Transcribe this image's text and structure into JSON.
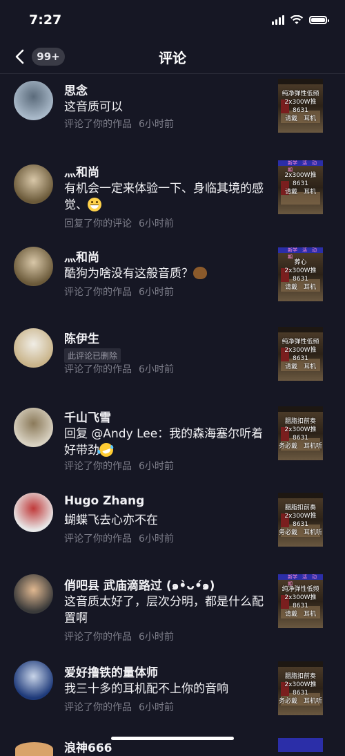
{
  "status_bar": {
    "time": "7:27"
  },
  "nav": {
    "back_badge": "99+",
    "title": "评论"
  },
  "items": [
    {
      "name": "思念",
      "comment": "这音质可以",
      "meta_action": "评论了你的作品",
      "meta_time": "6小时前",
      "thumb_text": "纯净弹性低频\n2x300W推8631\n请戴　耳机",
      "avatar_colors": [
        "#a9b9c9",
        "#5b6b7b"
      ]
    },
    {
      "name": "灬和尚",
      "comment": "有机会一定来体验一下、身临其境的感觉、",
      "emoji": "grin",
      "meta_action": "回复了你的评论",
      "meta_time": "6小时前",
      "thumb_text": "2x300W推8631\n请戴　耳机",
      "thumb_header": "新学　活　动　期",
      "avatar_colors": [
        "#6b5a3a",
        "#d8c7a8"
      ]
    },
    {
      "name": "灬和尚",
      "comment": "酷狗为啥没有这般音质？",
      "emoji": "poo",
      "meta_action": "评论了你的作品",
      "meta_time": "6小时前",
      "thumb_text": "葬心\n2x300W推8631\n请戴　耳机",
      "thumb_header": "新学　活　动　期",
      "avatar_colors": [
        "#6b5a3a",
        "#d8c7a8"
      ]
    },
    {
      "name": "陈伊生",
      "deleted": "此评论已删除",
      "meta_action": "评论了你的作品",
      "meta_time": "6小时前",
      "thumb_text": "纯净弹性低频\n2x300W推8631\n请戴　耳机",
      "avatar_colors": [
        "#c9b48a",
        "#f0ede6"
      ]
    },
    {
      "name": "千山飞雪",
      "comment": "回复 @Andy Lee：我的森海塞尔听着好带劲",
      "emoji": "laugh",
      "meta_action": "评论了你的作品",
      "meta_time": "6小时前",
      "thumb_text": "胭脂扣前奏\n2x300W推8631\n务必戴　耳机听",
      "avatar_colors": [
        "#d9d2c2",
        "#8b7a5a"
      ]
    },
    {
      "name": "Hugo Zhang",
      "comment": "蝴蝶飞去心亦不在",
      "meta_action": "评论了你的作品",
      "meta_time": "6小时前",
      "thumb_text": "胭脂扣前奏\n2x300W推8631\n务必戴　耳机听",
      "avatar_colors": [
        "#e8e8e8",
        "#c03a3a"
      ]
    },
    {
      "name": "俏吧县  武庙滴路过 (๑•̀ᴗ•́๑)",
      "comment": "这音质太好了，层次分明，都是什么配置啊",
      "meta_action": "评论了你的作品",
      "meta_time": "6小时前",
      "thumb_text": "纯净弹性低频\n2x300W推8631\n请戴　耳机",
      "thumb_header": "新学　活　动　期",
      "avatar_colors": [
        "#3a3a3a",
        "#e0b890"
      ]
    },
    {
      "name": "爱好撸铁的量体师",
      "comment": "我三十多的耳机配不上你的音响",
      "meta_action": "评论了你的作品",
      "meta_time": "6小时前",
      "thumb_text": "胭脂扣前奏\n2x300W推8631\n务必戴　耳机听",
      "avatar_colors": [
        "#1e3a7a",
        "#c8d4e8"
      ]
    }
  ],
  "peek_name": "浪神666"
}
